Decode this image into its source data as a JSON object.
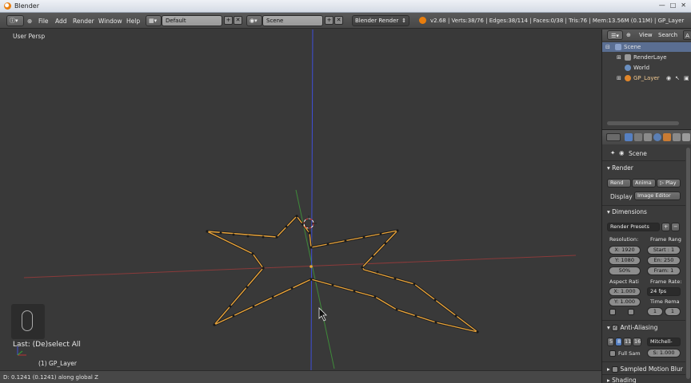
{
  "window": {
    "title": "Blender"
  },
  "header": {
    "menus": [
      "File",
      "Add",
      "Render",
      "Window",
      "Help"
    ],
    "layout": "Default",
    "scene": "Scene",
    "engine": "Blender Render",
    "stats": "v2.68 | Verts:38/76 | Edges:38/114 | Faces:0/38 | Tris:76 | Mem:13.56M (0.11M) | GP_Layer"
  },
  "viewport": {
    "view_label": "User Persp",
    "last_operator": "Last: (De)select All",
    "object_label": "(1) GP_Layer"
  },
  "statusbar": {
    "text": "D: 0.1241 (0.1241) along global Z"
  },
  "outliner": {
    "view_label": "View",
    "search_label": "Search",
    "extra_label": "A",
    "items": [
      {
        "label": "Scene"
      },
      {
        "label": "RenderLaye"
      },
      {
        "label": "World"
      },
      {
        "label": "GP_Layer"
      }
    ]
  },
  "properties": {
    "scene_label": "Scene",
    "render_section": "Render",
    "render_buttons": [
      "Rend",
      "Anima",
      "Play"
    ],
    "display_label": "Display",
    "display_value": "Image Editor",
    "dimensions_section": "Dimensions",
    "render_presets": "Render Presets",
    "resolution_label": "Resolution:",
    "frame_range_label": "Frame Rang",
    "res_x": "X: 1920",
    "res_y": "Y: 1080",
    "res_pct": "50%",
    "frame_start": "Start : 1",
    "frame_end": "En: 250",
    "frame_step": "Fram: 1",
    "aspect_label": "Aspect Rati",
    "frame_rate_label": "Frame Rate:",
    "aspect_x": "X: 1.000",
    "aspect_y": "Y: 1.000",
    "fps": "24 fps",
    "time_remap_label": "Time Rema",
    "time_old": "1",
    "time_new": "1",
    "aa_section": "Anti-Aliasing",
    "aa_samples": [
      "5",
      "8",
      "11",
      "16"
    ],
    "aa_filter": "Mitchell-",
    "full_sample_label": "Full Sam",
    "filter_size": "S: 1.000",
    "motion_blur_section": "Sampled Motion Blur",
    "shading_section": "Shading"
  },
  "colors": {
    "edge": "#e8a33a",
    "vertex": "#1a1a1a",
    "axis_x": "#8a3a3a",
    "axis_y": "#3f8a3a",
    "axis_z": "#3f4fd8",
    "accent": "#5680c2"
  }
}
